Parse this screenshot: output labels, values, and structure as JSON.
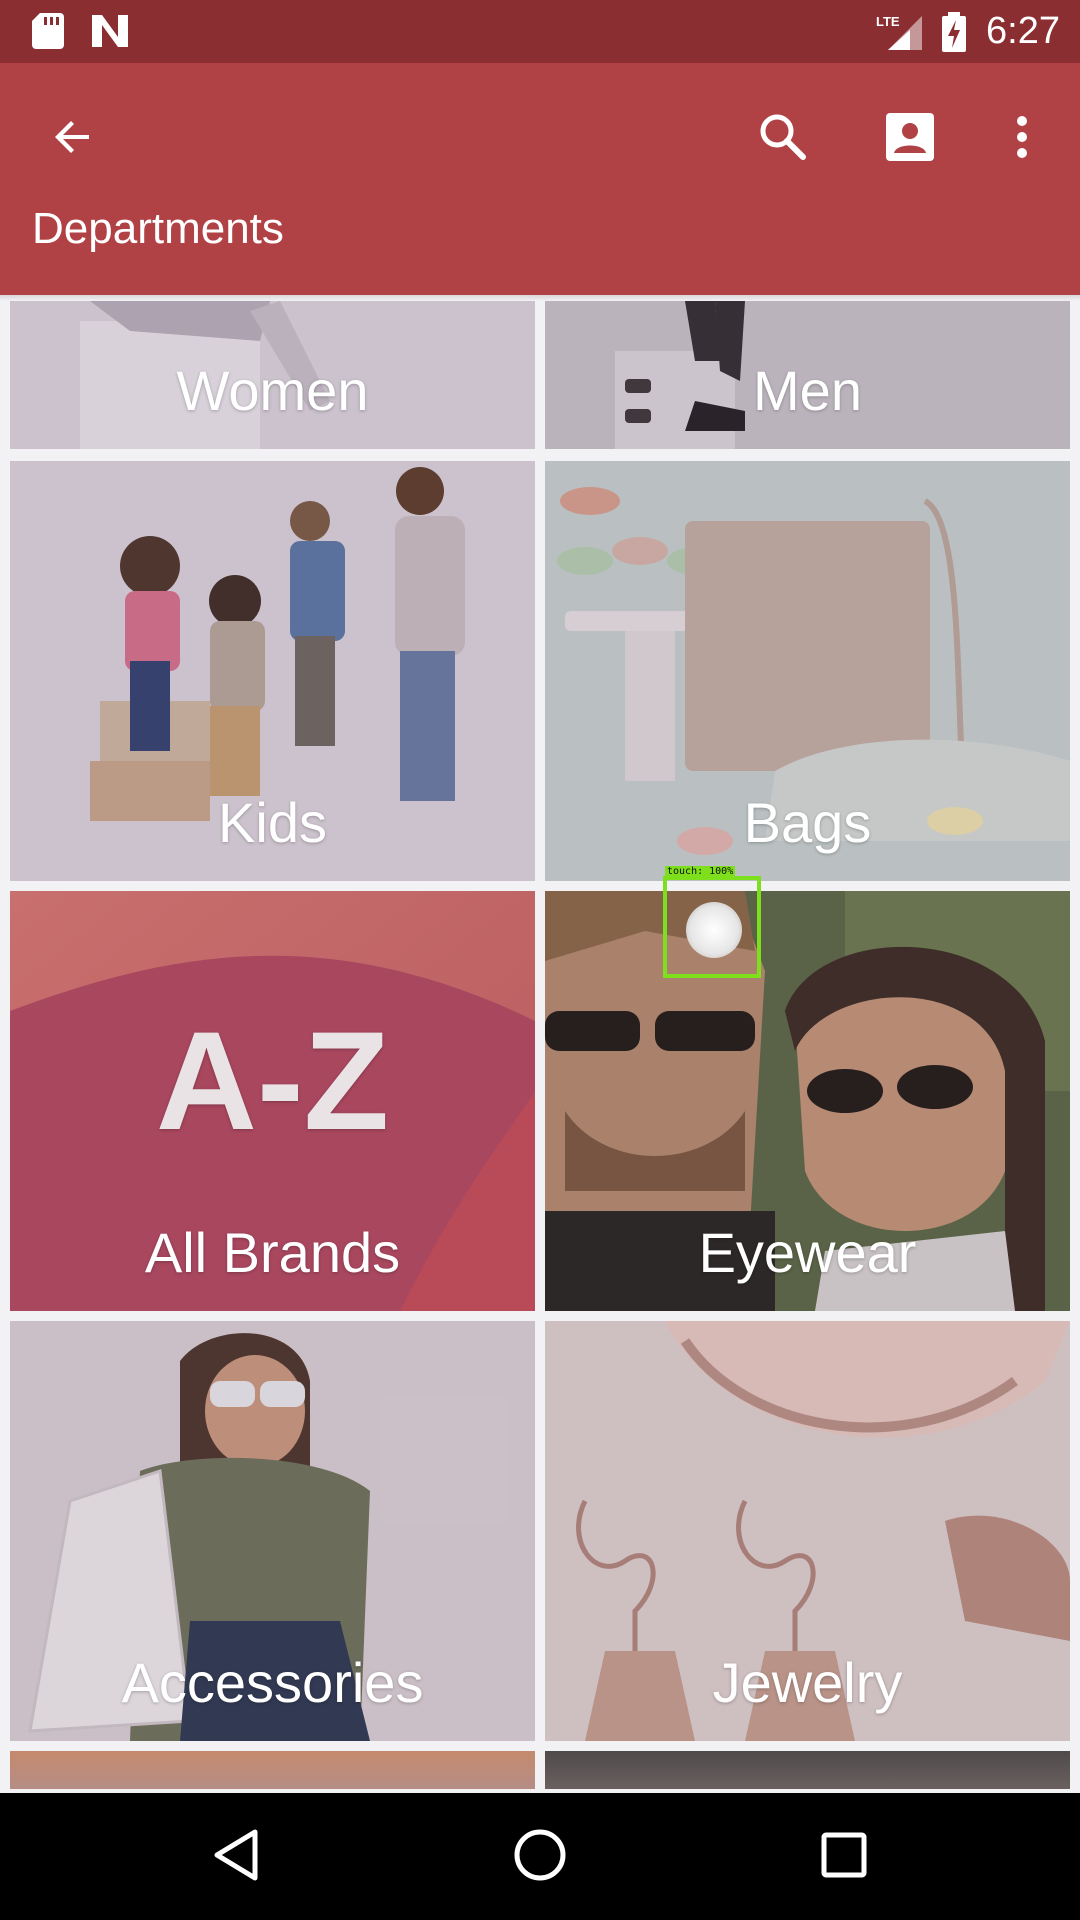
{
  "status_bar": {
    "time": "6:27",
    "network": "LTE",
    "icons": [
      "sd-card-icon",
      "n-icon",
      "lte-signal-icon",
      "battery-charging-icon"
    ]
  },
  "app_bar": {
    "title": "Departments",
    "icons": [
      "back-arrow-icon",
      "search-icon",
      "account-icon",
      "more-vert-icon"
    ]
  },
  "departments": [
    {
      "label": "Women"
    },
    {
      "label": "Men"
    },
    {
      "label": "Kids"
    },
    {
      "label": "Bags"
    },
    {
      "label": "All Brands",
      "logo_text": "A-Z"
    },
    {
      "label": "Eyewear"
    },
    {
      "label": "Accessories"
    },
    {
      "label": "Jewelry"
    }
  ],
  "touch_indicator": {
    "label": "touch: 100%"
  },
  "nav_bar": {
    "icons": [
      "back-triangle-icon",
      "home-circle-icon",
      "recents-square-icon"
    ]
  },
  "colors": {
    "status_bar": "#8b2e31",
    "app_bar": "#b04246",
    "nav_bar": "#000000",
    "touch_box": "#7ee01c"
  }
}
